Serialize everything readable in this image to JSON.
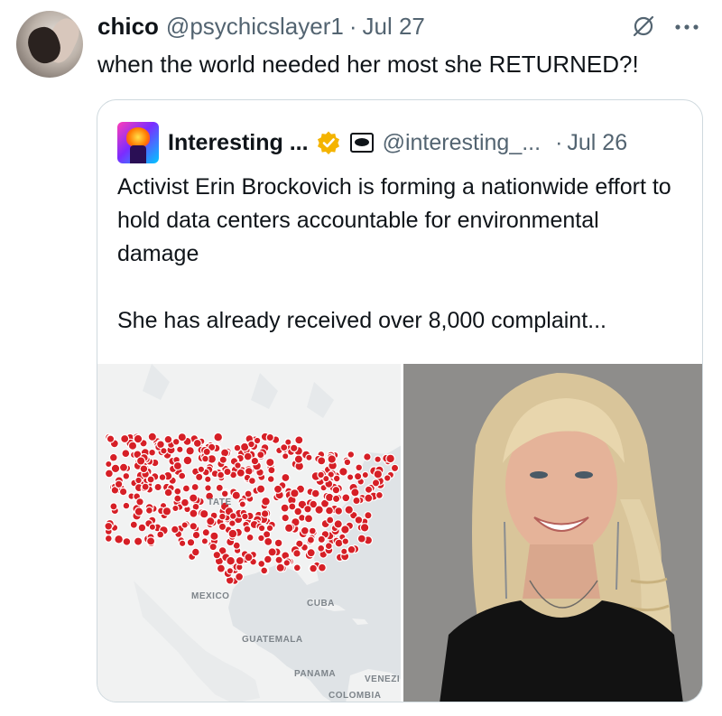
{
  "tweet": {
    "author_name": "chico",
    "author_handle": "@psychicslayer1",
    "separator": "·",
    "date": "Jul 27",
    "text": "when the world needed her most she RETURNED?!",
    "icons": {
      "avatar": "user-avatar",
      "hide": "slashed-circle-icon",
      "more": "more-dots-icon"
    }
  },
  "quote": {
    "author_name": "Interesting ...",
    "author_handle": "@interesting_...",
    "separator": "·",
    "date": "Jul 26",
    "paragraph1": "Activist Erin Brockovich is forming a nationwide effort to hold data centers accountable for environmental damage",
    "paragraph2": "She has already received over 8,000 complaint...",
    "icons": {
      "verified": "gold-verified-badge-icon",
      "affiliate": "affiliate-badge-icon"
    },
    "colors": {
      "verified_gold": "#f4b400",
      "marker_red": "#d61f26"
    }
  },
  "media": {
    "map_labels": {
      "states": "TATE",
      "mexico": "MEXICO",
      "cuba": "CUBA",
      "guatemala": "GUATEMALA",
      "panama": "PANAMA",
      "venezuela": "VENEZI",
      "colombia": "COLOMBIA"
    }
  }
}
